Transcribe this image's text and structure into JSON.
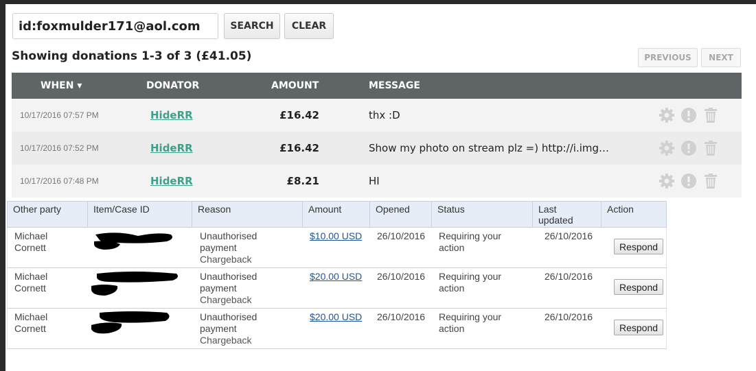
{
  "search": {
    "value": "id:foxmulder171@aol.com",
    "search_label": "SEARCH",
    "clear_label": "CLEAR"
  },
  "summary": "Showing donations 1-3 of 3 (£41.05)",
  "pager": {
    "previous": "PREVIOUS",
    "next": "NEXT"
  },
  "donations": {
    "headers": {
      "when": "WHEN ▾",
      "donator": "DONATOR",
      "amount": "AMOUNT",
      "message": "MESSAGE"
    },
    "rows": [
      {
        "date": "10/17/2016 07:57 PM",
        "donator": "HideRR",
        "amount": "£16.42",
        "message": "thx :D"
      },
      {
        "date": "10/17/2016 07:52 PM",
        "donator": "HideRR",
        "amount": "£16.42",
        "message": "Show my photo on stream plz =) http://i.img…"
      },
      {
        "date": "10/17/2016 07:48 PM",
        "donator": "HideRR",
        "amount": "£8.21",
        "message": "HI"
      }
    ],
    "row_icons": [
      "gear-icon",
      "alert-icon",
      "trash-icon"
    ]
  },
  "disputes": {
    "headers": {
      "other_party": "Other party",
      "item_id": "Item/Case ID",
      "reason": "Reason",
      "amount": "Amount",
      "opened": "Opened",
      "status": "Status",
      "last_updated_1": "Last",
      "last_updated_2": "updated",
      "action": "Action"
    },
    "rows": [
      {
        "party1": "Michael",
        "party2": "Cornett",
        "reason1": "Unauthorised",
        "reason2": "payment",
        "reason3": "Chargeback",
        "amount": "$10.00 USD",
        "opened": "26/10/2016",
        "status1": "Requiring your",
        "status2": "action",
        "updated": "26/10/2016",
        "action": "Respond"
      },
      {
        "party1": "Michael",
        "party2": "Cornett",
        "reason1": "Unauthorised",
        "reason2": "payment",
        "reason3": "Chargeback",
        "amount": "$20.00 USD",
        "opened": "26/10/2016",
        "status1": "Requiring your",
        "status2": "action",
        "updated": "26/10/2016",
        "action": "Respond"
      },
      {
        "party1": "Michael",
        "party2": "Cornett",
        "reason1": "Unauthorised",
        "reason2": "payment",
        "reason3": "Chargeback",
        "amount": "$20.00 USD",
        "opened": "26/10/2016",
        "status1": "Requiring your",
        "status2": "action",
        "updated": "26/10/2016",
        "action": "Respond"
      }
    ]
  },
  "colors": {
    "header_bg": "#5f6566",
    "donor_link": "#3e9f8c",
    "amount_link": "#1f5596",
    "icon_grey": "#d0d0d0",
    "redaction": "#000000"
  }
}
